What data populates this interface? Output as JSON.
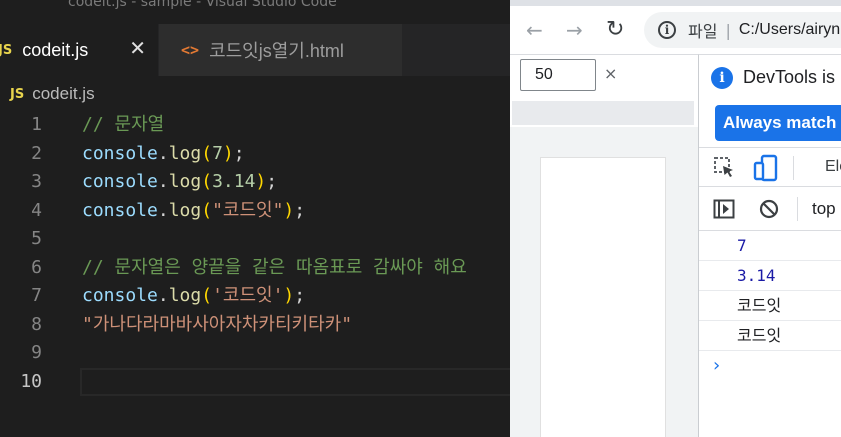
{
  "vscode": {
    "window_title": "codeit.js - sample - Visual Studio Code",
    "tabs": [
      {
        "label": "codeit.js",
        "icon": "JS",
        "active": true
      },
      {
        "label": "코드잇js열기.html",
        "icon": "<>",
        "active": false
      }
    ],
    "close_glyph": "✕",
    "breadcrumb": {
      "icon": "JS",
      "label": "codeit.js"
    },
    "lines": [
      {
        "num": "1",
        "tokens": [
          [
            "comment",
            "// 문자열"
          ]
        ]
      },
      {
        "num": "2",
        "tokens": [
          [
            "obj",
            "console"
          ],
          [
            "punc",
            "."
          ],
          [
            "fn",
            "log"
          ],
          [
            "paren",
            "("
          ],
          [
            "num",
            "7"
          ],
          [
            "paren",
            ")"
          ],
          [
            "punc",
            ";"
          ]
        ]
      },
      {
        "num": "3",
        "tokens": [
          [
            "obj",
            "console"
          ],
          [
            "punc",
            "."
          ],
          [
            "fn",
            "log"
          ],
          [
            "paren",
            "("
          ],
          [
            "num",
            "3.14"
          ],
          [
            "paren",
            ")"
          ],
          [
            "punc",
            ";"
          ]
        ]
      },
      {
        "num": "4",
        "tokens": [
          [
            "obj",
            "console"
          ],
          [
            "punc",
            "."
          ],
          [
            "fn",
            "log"
          ],
          [
            "paren",
            "("
          ],
          [
            "str",
            "\"코드잇\""
          ],
          [
            "paren",
            ")"
          ],
          [
            "punc",
            ";"
          ]
        ]
      },
      {
        "num": "5",
        "tokens": []
      },
      {
        "num": "6",
        "tokens": [
          [
            "comment",
            "// 문자열은 양끝을 같은 따옴표로 감싸야 해요"
          ]
        ]
      },
      {
        "num": "7",
        "tokens": [
          [
            "obj",
            "console"
          ],
          [
            "punc",
            "."
          ],
          [
            "fn",
            "log"
          ],
          [
            "paren",
            "("
          ],
          [
            "str",
            "'코드잇'"
          ],
          [
            "paren",
            ")"
          ],
          [
            "punc",
            ";"
          ]
        ]
      },
      {
        "num": "8",
        "tokens": [
          [
            "str",
            "\"가나다라마바사아자차카티키타카\""
          ]
        ]
      },
      {
        "num": "9",
        "tokens": []
      },
      {
        "num": "10",
        "tokens": [],
        "active": true
      }
    ],
    "colors": {
      "comment": "#6a9955",
      "obj": "#9cdcfe",
      "fn": "#dcdcaa",
      "num": "#b5cea8",
      "str": "#ce9178",
      "js_badge": "#e8d44d"
    }
  },
  "chrome": {
    "back_glyph": "←",
    "forward_glyph": "→",
    "reload_glyph": "↻",
    "omnibox": {
      "info_glyph": "i",
      "scheme": "파일",
      "separator": "|",
      "url": "C:/Users/airyn"
    },
    "zoom": {
      "value": "50",
      "close_glyph": "×"
    },
    "devtools": {
      "info_glyph": "i",
      "info_text": "DevTools is now available in Korean",
      "match_button": "Always match Chrome's language",
      "elements_tab": "Elements",
      "context": "top",
      "console_messages": [
        {
          "text": "7",
          "kind": "num"
        },
        {
          "text": "3.14",
          "kind": "num"
        },
        {
          "text": "코드잇",
          "kind": "str"
        },
        {
          "text": "코드잇",
          "kind": "str"
        }
      ],
      "prompt_glyph": "›"
    },
    "accent": "#1a73e8"
  }
}
